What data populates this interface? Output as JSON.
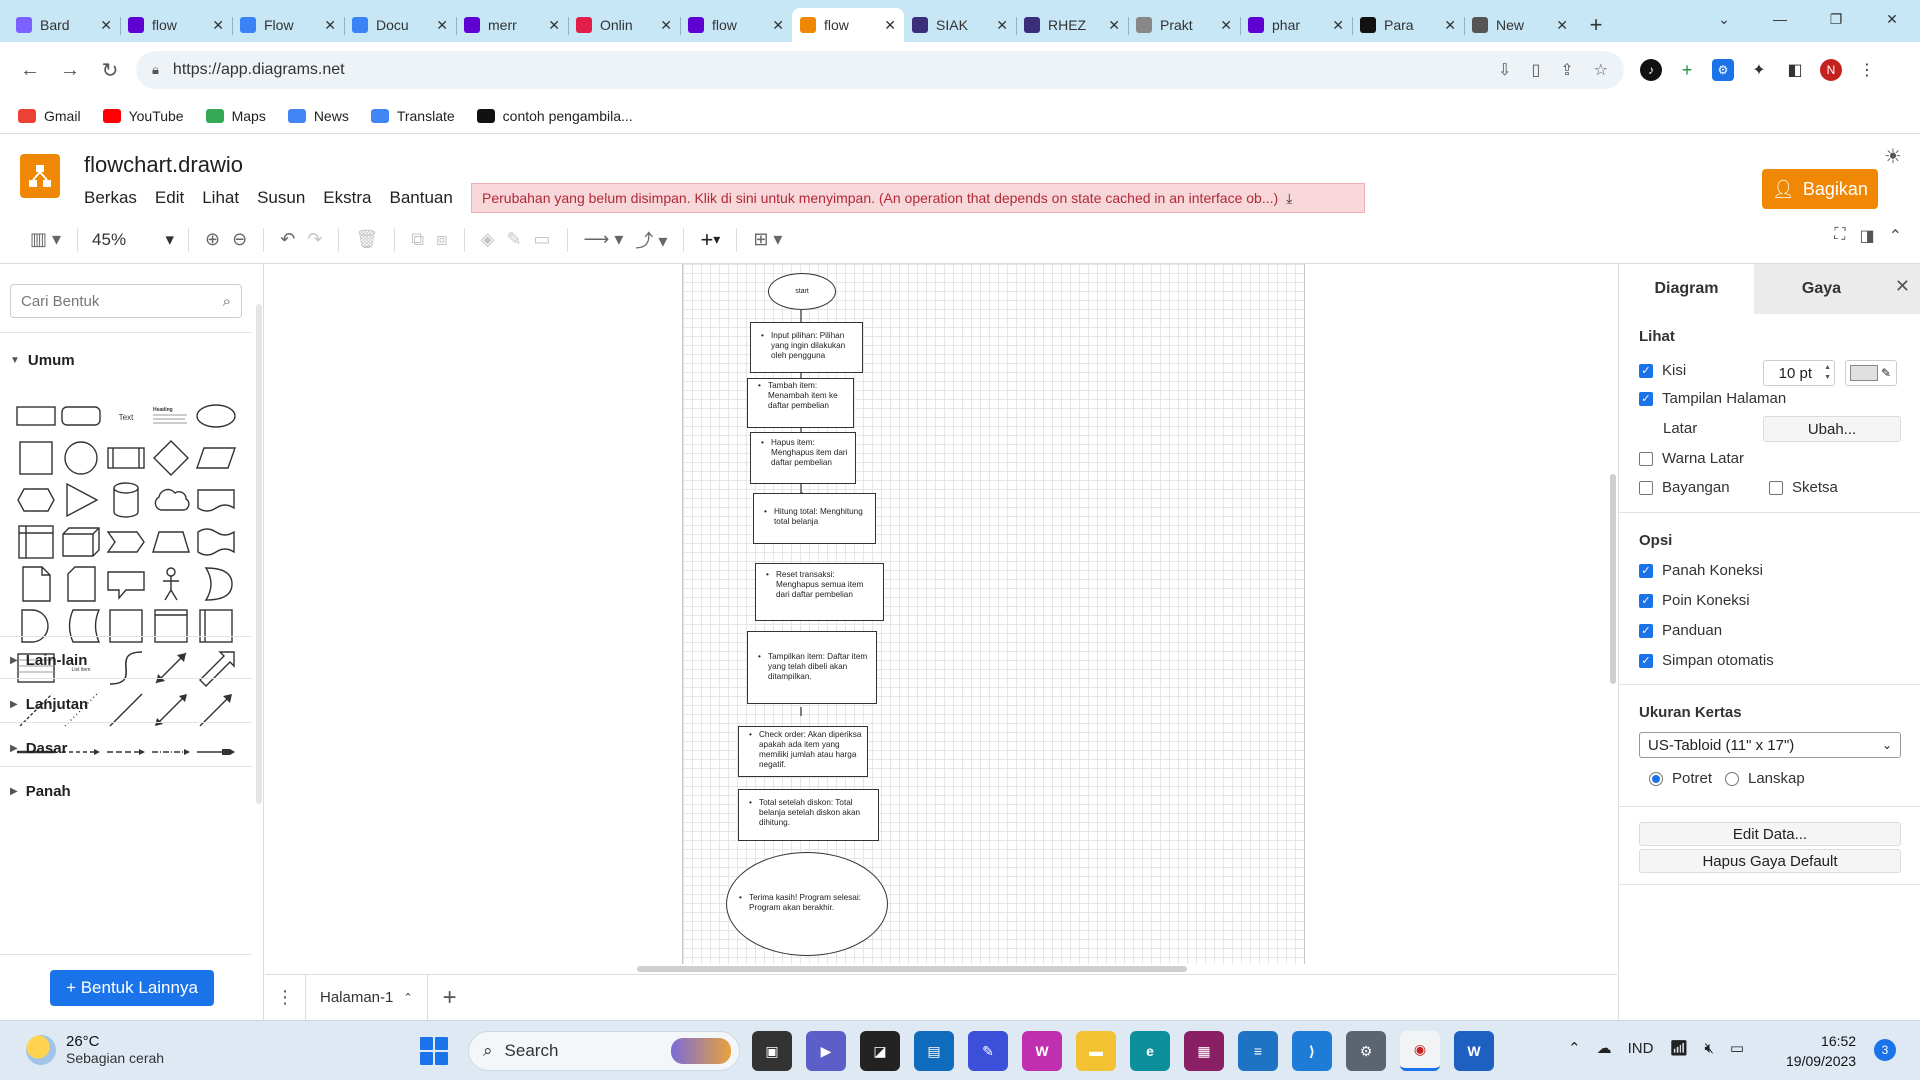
{
  "browser": {
    "tabs": [
      {
        "title": "Bard",
        "icon": "bard-icon",
        "color": "#7b61ff",
        "active": false
      },
      {
        "title": "flow",
        "icon": "yahoo-icon",
        "color": "#6001d2",
        "active": false
      },
      {
        "title": "Flow",
        "icon": "flow-icon",
        "color": "#3b82f6",
        "active": false
      },
      {
        "title": "Docu",
        "icon": "docs-icon",
        "color": "#3b82f6",
        "active": false
      },
      {
        "title": "merr",
        "icon": "yahoo-icon",
        "color": "#6001d2",
        "active": false
      },
      {
        "title": "Onlin",
        "icon": "online-icon",
        "color": "#e11d48",
        "active": false
      },
      {
        "title": "flow",
        "icon": "yahoo-icon",
        "color": "#6001d2",
        "active": false
      },
      {
        "title": "flow",
        "icon": "drawio-icon",
        "color": "#f08705",
        "active": true
      },
      {
        "title": "SIAK",
        "icon": "siak-icon",
        "color": "#3b2f7a",
        "active": false
      },
      {
        "title": "RHEZ",
        "icon": "rhez-icon",
        "color": "#3b2f7a",
        "active": false
      },
      {
        "title": "Prakt",
        "icon": "prakt-icon",
        "color": "#888888",
        "active": false
      },
      {
        "title": "phar",
        "icon": "yahoo-icon",
        "color": "#6001d2",
        "active": false
      },
      {
        "title": "Para",
        "icon": "para-icon",
        "color": "#111111",
        "active": false
      },
      {
        "title": "New",
        "icon": "globe-icon",
        "color": "#555555",
        "active": false
      }
    ],
    "url": "https://app.diagrams.net",
    "profile_initial": "N",
    "bookmarks": [
      {
        "label": "Gmail",
        "icon": "gmail-icon",
        "color": "#ea4335"
      },
      {
        "label": "YouTube",
        "icon": "youtube-icon",
        "color": "#ff0000"
      },
      {
        "label": "Maps",
        "icon": "maps-icon",
        "color": "#34a853"
      },
      {
        "label": "News",
        "icon": "news-icon",
        "color": "#4285f4"
      },
      {
        "label": "Translate",
        "icon": "translate-icon",
        "color": "#4285f4"
      },
      {
        "label": "contoh pengambila...",
        "icon": "bookmark-icon",
        "color": "#111111"
      }
    ]
  },
  "app": {
    "file_title": "flowchart.drawio",
    "menus": [
      "Berkas",
      "Edit",
      "Lihat",
      "Susun",
      "Ekstra",
      "Bantuan"
    ],
    "unsaved_msg": "Perubahan yang belum disimpan. Klik di sini untuk menyimpan. (An operation that depends on state cached in an interface ob...)",
    "share_label": "Bagikan",
    "accent": "#f08705",
    "zoom": "45%"
  },
  "sidebar": {
    "search_placeholder": "Cari Bentuk",
    "general_label": "Umum",
    "sections": [
      "Lain-lain",
      "Lanjutan",
      "Dasar",
      "Panah"
    ],
    "more_shapes": "+ Bentuk Lainnya",
    "text_sample": "Text",
    "heading_sample": "Heading",
    "list_sample": "List Item"
  },
  "canvas": {
    "nodes": [
      {
        "text": "start",
        "shape": "ellipse"
      },
      {
        "text": "Input pilihan: Pilihan yang ingin dilakukan oleh pengguna",
        "shape": "rect"
      },
      {
        "text": "Tambah item: Menambah item ke daftar pembelian",
        "shape": "rect"
      },
      {
        "text": "Hapus item: Menghapus item dari daftar pembelian",
        "shape": "rect"
      },
      {
        "text": "Hitung total: Menghitung total belanja",
        "shape": "rect"
      },
      {
        "text": "Reset transaksi: Menghapus semua item dari daftar pembelian",
        "shape": "rect"
      },
      {
        "text": "Tampilkan item: Daftar item yang telah dibeli akan ditampilkan.",
        "shape": "rect"
      },
      {
        "text": "Check order: Akan diperiksa apakah ada item yang memiliki jumlah atau harga negatif.",
        "shape": "rect"
      },
      {
        "text": "Total setelah diskon: Total belanja setelah diskon akan dihitung.",
        "shape": "rect"
      },
      {
        "text": "Terima kasih! Program selesai: Program akan berakhir.",
        "shape": "ellipse"
      }
    ]
  },
  "pages": {
    "tab": "Halaman-1"
  },
  "panel": {
    "tab_diagram": "Diagram",
    "tab_style": "Gaya",
    "view_head": "Lihat",
    "grid_label": "Kisi",
    "grid_size": "10 pt",
    "page_view_label": "Tampilan Halaman",
    "background_label": "Latar",
    "change_label": "Ubah...",
    "bg_color_label": "Warna Latar",
    "shadow_label": "Bayangan",
    "sketch_label": "Sketsa",
    "options_head": "Opsi",
    "opt_arrows": "Panah Koneksi",
    "opt_points": "Poin Koneksi",
    "opt_guides": "Panduan",
    "opt_autosave": "Simpan otomatis",
    "paper_head": "Ukuran Kertas",
    "paper_size": "US-Tabloid (11\" x 17\")",
    "portrait": "Potret",
    "landscape": "Lanskap",
    "edit_data": "Edit Data...",
    "reset_style": "Hapus Gaya Default"
  },
  "taskbar": {
    "temp": "26°C",
    "condition": "Sebagian cerah",
    "search": "Search",
    "lang": "IND",
    "time": "16:52",
    "date": "19/09/2023",
    "notifications": "3"
  }
}
